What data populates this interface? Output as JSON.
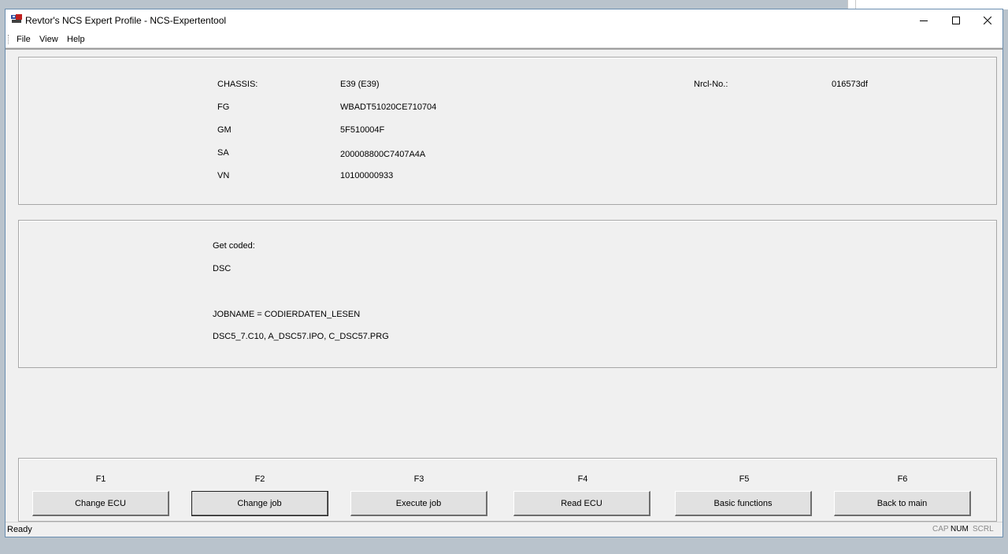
{
  "window": {
    "title": "Revtor's NCS Expert Profile - NCS-Expertentool"
  },
  "menu": {
    "file": "File",
    "view": "View",
    "help": "Help"
  },
  "vehicle": {
    "chassis_label": "CHASSIS:",
    "chassis_value": "E39 (E39)",
    "fg_label": "FG",
    "fg_value": "WBADT51020CE710704",
    "gm_label": "GM",
    "gm_value": "5F510004F",
    "sa_label": "SA",
    "sa_value": "200008800C7407A4A",
    "vn_label": "VN",
    "vn_value": "10100000933",
    "nrcl_label": "Nrcl-No.:",
    "nrcl_value": "016573df"
  },
  "job": {
    "get_coded_label": "Get coded:",
    "module": "DSC",
    "jobname": "JOBNAME = CODIERDATEN_LESEN",
    "files": "DSC5_7.C10, A_DSC57.IPO, C_DSC57.PRG"
  },
  "function_keys": [
    {
      "key": "F1",
      "label": "Change ECU"
    },
    {
      "key": "F2",
      "label": "Change job"
    },
    {
      "key": "F3",
      "label": "Execute job"
    },
    {
      "key": "F4",
      "label": "Read ECU"
    },
    {
      "key": "F5",
      "label": "Basic functions"
    },
    {
      "key": "F6",
      "label": "Back to main"
    }
  ],
  "status": {
    "text": "Ready",
    "cap": "CAP",
    "num": "NUM",
    "scrl": "SCRL",
    "cap_active": false,
    "num_active": true,
    "scrl_active": false
  },
  "icons": [
    "app-icon",
    "minimize-icon",
    "maximize-icon",
    "close-icon"
  ]
}
